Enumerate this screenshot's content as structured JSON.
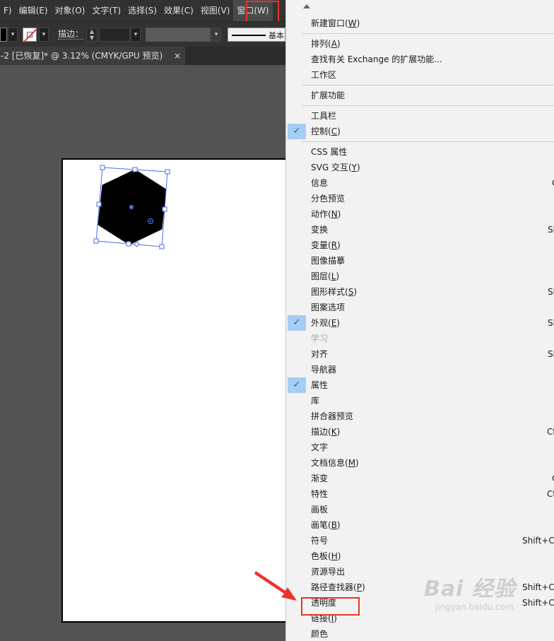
{
  "menubar": {
    "items": [
      {
        "label": "F)",
        "active": false
      },
      {
        "label": "编辑(E)",
        "active": false
      },
      {
        "label": "对象(O)",
        "active": false
      },
      {
        "label": "文字(T)",
        "active": false
      },
      {
        "label": "选择(S)",
        "active": false
      },
      {
        "label": "效果(C)",
        "active": false
      },
      {
        "label": "视图(V)",
        "active": false
      },
      {
        "label": "窗口(W)",
        "active": true
      }
    ]
  },
  "control_bar": {
    "stroke_label": "描边：",
    "profile_label": "基本"
  },
  "document_tab": {
    "title": "-2 [已恢复]* @ 3.12% (CMYK/GPU 预览)",
    "close": "×"
  },
  "window_menu": {
    "items": [
      {
        "label": "新建窗口(W)",
        "key": "W",
        "shortcut": "",
        "checked": false,
        "disabled": false
      },
      {
        "sep": true
      },
      {
        "label": "排列(A)",
        "key": "A",
        "shortcut": "",
        "checked": false,
        "disabled": false
      },
      {
        "label": "查找有关 Exchange 的扩展功能...",
        "shortcut": "",
        "checked": false,
        "disabled": false
      },
      {
        "label": "工作区",
        "shortcut": "",
        "checked": false,
        "disabled": false
      },
      {
        "sep": true
      },
      {
        "label": "扩展功能",
        "shortcut": "",
        "checked": false,
        "disabled": false
      },
      {
        "sep": true
      },
      {
        "label": "工具栏",
        "shortcut": "",
        "checked": false,
        "disabled": false
      },
      {
        "label": "控制(C)",
        "key": "C",
        "shortcut": "",
        "checked": true,
        "disabled": false
      },
      {
        "sep": true
      },
      {
        "label": "CSS 属性",
        "shortcut": "",
        "checked": false,
        "disabled": false
      },
      {
        "label": "SVG 交互(Y)",
        "key": "Y",
        "shortcut": "",
        "checked": false,
        "disabled": false
      },
      {
        "label": "信息",
        "shortcut": "C",
        "checked": false,
        "disabled": false
      },
      {
        "label": "分色预览",
        "shortcut": "",
        "checked": false,
        "disabled": false
      },
      {
        "label": "动作(N)",
        "key": "N",
        "shortcut": "",
        "checked": false,
        "disabled": false
      },
      {
        "label": "变换",
        "shortcut": "Sh",
        "checked": false,
        "disabled": false
      },
      {
        "label": "变量(R)",
        "key": "R",
        "shortcut": "",
        "checked": false,
        "disabled": false
      },
      {
        "label": "图像描摹",
        "shortcut": "",
        "checked": false,
        "disabled": false
      },
      {
        "label": "图层(L)",
        "key": "L",
        "shortcut": "",
        "checked": false,
        "disabled": false
      },
      {
        "label": "图形样式(S)",
        "key": "S",
        "shortcut": "Sh",
        "checked": false,
        "disabled": false
      },
      {
        "label": "图案选项",
        "shortcut": "",
        "checked": false,
        "disabled": false
      },
      {
        "label": "外观(E)",
        "key": "E",
        "shortcut": "Sh",
        "checked": true,
        "disabled": false
      },
      {
        "label": "学习",
        "shortcut": "",
        "checked": false,
        "disabled": true
      },
      {
        "label": "对齐",
        "shortcut": "Sh",
        "checked": false,
        "disabled": false
      },
      {
        "label": "导航器",
        "shortcut": "",
        "checked": false,
        "disabled": false
      },
      {
        "label": "属性",
        "shortcut": "",
        "checked": true,
        "disabled": false
      },
      {
        "label": "库",
        "shortcut": "",
        "checked": false,
        "disabled": false
      },
      {
        "label": "拼合器预览",
        "shortcut": "",
        "checked": false,
        "disabled": false
      },
      {
        "label": "描边(K)",
        "key": "K",
        "shortcut": "Ct",
        "checked": false,
        "disabled": false
      },
      {
        "label": "文字",
        "shortcut": "",
        "checked": false,
        "disabled": false
      },
      {
        "label": "文档信息(M)",
        "key": "M",
        "shortcut": "",
        "checked": false,
        "disabled": false
      },
      {
        "label": "渐变",
        "shortcut": "C",
        "checked": false,
        "disabled": false
      },
      {
        "label": "特性",
        "shortcut": "Ct",
        "checked": false,
        "disabled": false
      },
      {
        "label": "画板",
        "shortcut": "",
        "checked": false,
        "disabled": false
      },
      {
        "label": "画笔(B)",
        "key": "B",
        "shortcut": "",
        "checked": false,
        "disabled": false
      },
      {
        "label": "符号",
        "shortcut": "Shift+Ct",
        "checked": false,
        "disabled": false
      },
      {
        "label": "色板(H)",
        "key": "H",
        "shortcut": "",
        "checked": false,
        "disabled": false
      },
      {
        "label": "资源导出",
        "shortcut": "",
        "checked": false,
        "disabled": false
      },
      {
        "label": "路径查找器(P)",
        "key": "P",
        "shortcut": "Shift+Ct",
        "checked": false,
        "disabled": false
      },
      {
        "label": "透明度",
        "shortcut": "Shift+Ct",
        "checked": false,
        "disabled": false,
        "highlighted": true
      },
      {
        "label": "链接(I)",
        "key": "I",
        "shortcut": "",
        "checked": false,
        "disabled": false
      },
      {
        "label": "颜色",
        "shortcut": "",
        "checked": false,
        "disabled": false
      }
    ]
  },
  "watermark": {
    "main": "Bai 经验",
    "sub": "jingyan.baidu.com"
  },
  "colors": {
    "highlight_box": "#e8342c",
    "check_bg": "#a6cdf3",
    "selection": "#4a6fe6"
  }
}
